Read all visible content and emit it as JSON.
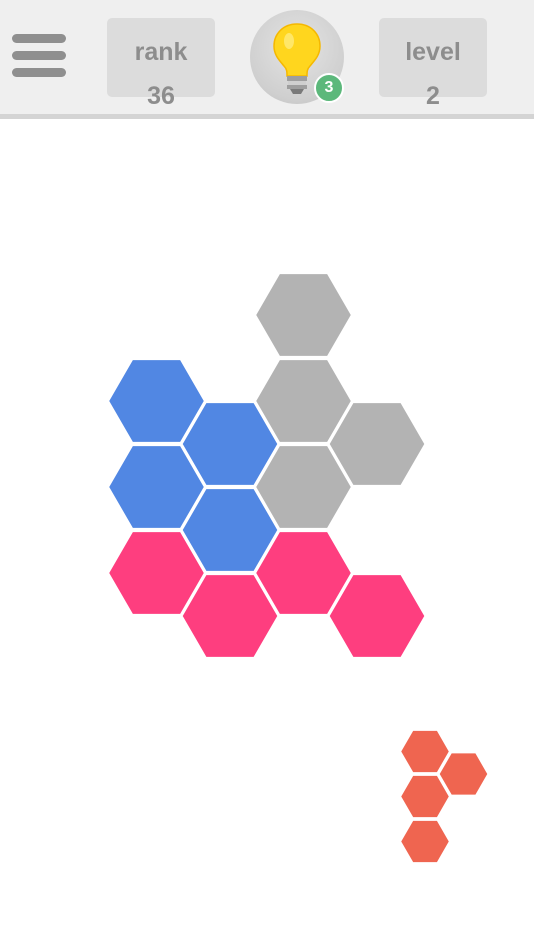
{
  "header": {
    "menu_icon": "hamburger-menu-icon",
    "rank": {
      "label": "rank",
      "value": "36"
    },
    "hint": {
      "icon": "lightbulb-icon",
      "count": "3"
    },
    "level": {
      "label": "level",
      "value": "2"
    }
  },
  "colors": {
    "gray": "#b3b3b3",
    "blue": "#5187e3",
    "pink": "#fe3e7f",
    "orange": "#ef6550"
  },
  "board": {
    "pieces": [
      {
        "name": "gray-piece",
        "color": "gray",
        "cells": [
          [
            3,
            0
          ],
          [
            3,
            1
          ],
          [
            4,
            1
          ],
          [
            3,
            2
          ]
        ]
      },
      {
        "name": "blue-piece",
        "color": "blue",
        "cells": [
          [
            1,
            1
          ],
          [
            2,
            1
          ],
          [
            1,
            2
          ],
          [
            2,
            2
          ]
        ]
      },
      {
        "name": "pink-piece",
        "color": "pink",
        "cells": [
          [
            1,
            3
          ],
          [
            2,
            3
          ],
          [
            3,
            3
          ],
          [
            4,
            3
          ]
        ]
      }
    ]
  },
  "tray": {
    "pieces": [
      {
        "name": "orange-piece",
        "color": "orange",
        "cells": [
          [
            0,
            0
          ],
          [
            0,
            1
          ],
          [
            1,
            1
          ],
          [
            0,
            2
          ]
        ]
      }
    ]
  }
}
